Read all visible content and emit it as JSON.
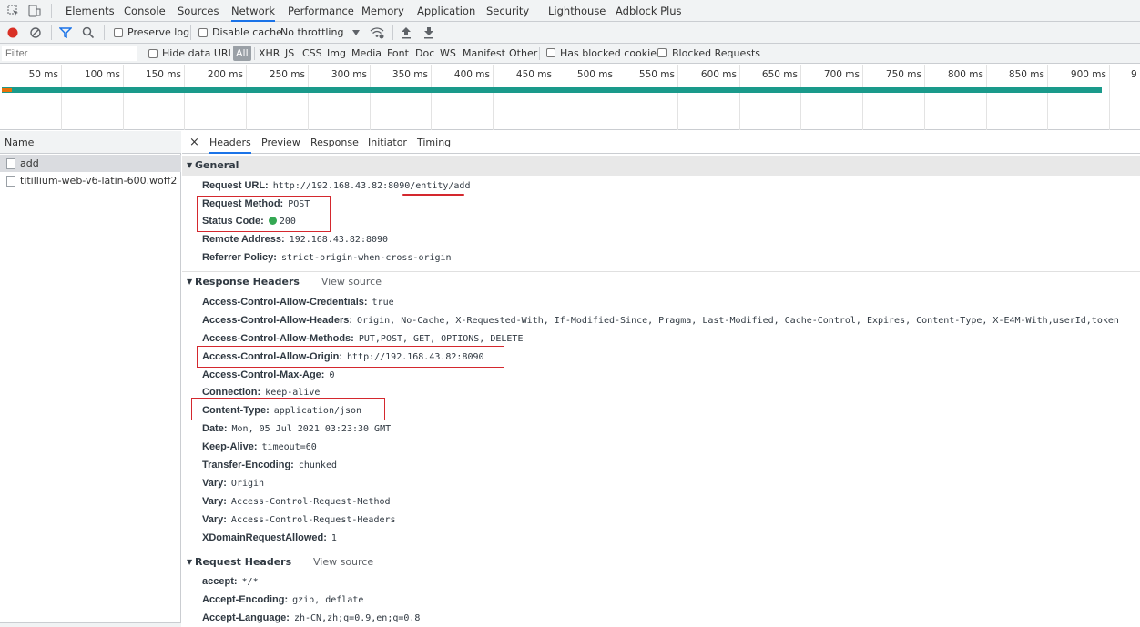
{
  "tabs": [
    "Elements",
    "Console",
    "Sources",
    "Network",
    "Performance",
    "Memory",
    "Application",
    "Security",
    "Lighthouse",
    "Adblock Plus"
  ],
  "selected_tab": "Network",
  "toolbar": {
    "preserve_log": "Preserve log",
    "disable_cache": "Disable cache",
    "throttling": "No throttling"
  },
  "filterbar": {
    "filter_placeholder": "Filter",
    "hide_data_urls": "Hide data URLs",
    "types": [
      "All",
      "XHR",
      "JS",
      "CSS",
      "Img",
      "Media",
      "Font",
      "Doc",
      "WS",
      "Manifest",
      "Other"
    ],
    "has_blocked_cookies": "Has blocked cookies",
    "blocked_requests": "Blocked Requests"
  },
  "timeline": {
    "ticks": [
      "50 ms",
      "100 ms",
      "150 ms",
      "200 ms",
      "250 ms",
      "300 ms",
      "350 ms",
      "400 ms",
      "450 ms",
      "500 ms",
      "550 ms",
      "600 ms",
      "650 ms",
      "700 ms",
      "750 ms",
      "800 ms",
      "850 ms",
      "900 ms",
      "9"
    ],
    "bar_color": "#1a9a8b",
    "bar_accent": "#e8710a"
  },
  "requests": {
    "header": "Name",
    "items": [
      "add",
      "titillium-web-v6-latin-600.woff2"
    ]
  },
  "detail_tabs": [
    "Headers",
    "Preview",
    "Response",
    "Initiator",
    "Timing"
  ],
  "close_label": "×",
  "general": {
    "title": "General",
    "rows": [
      {
        "k": "Request URL:",
        "v": "http://192.168.43.82:8090/entity/add"
      },
      {
        "k": "Request Method:",
        "v": "POST"
      },
      {
        "k": "Status Code:",
        "v": "200"
      },
      {
        "k": "Remote Address:",
        "v": "192.168.43.82:8090"
      },
      {
        "k": "Referrer Policy:",
        "v": "strict-origin-when-cross-origin"
      }
    ]
  },
  "response_headers": {
    "title": "Response Headers",
    "view_source": "View source",
    "rows": [
      {
        "k": "Access-Control-Allow-Credentials:",
        "v": "true"
      },
      {
        "k": "Access-Control-Allow-Headers:",
        "v": "Origin, No-Cache, X-Requested-With, If-Modified-Since, Pragma, Last-Modified, Cache-Control, Expires, Content-Type, X-E4M-With,userId,token"
      },
      {
        "k": "Access-Control-Allow-Methods:",
        "v": "PUT,POST, GET, OPTIONS, DELETE"
      },
      {
        "k": "Access-Control-Allow-Origin:",
        "v": "http://192.168.43.82:8090"
      },
      {
        "k": "Access-Control-Max-Age:",
        "v": "0"
      },
      {
        "k": "Connection:",
        "v": "keep-alive"
      },
      {
        "k": "Content-Type:",
        "v": "application/json"
      },
      {
        "k": "Date:",
        "v": "Mon, 05 Jul 2021 03:23:30 GMT"
      },
      {
        "k": "Keep-Alive:",
        "v": "timeout=60"
      },
      {
        "k": "Transfer-Encoding:",
        "v": "chunked"
      },
      {
        "k": "Vary:",
        "v": "Origin"
      },
      {
        "k": "Vary:",
        "v": "Access-Control-Request-Method"
      },
      {
        "k": "Vary:",
        "v": "Access-Control-Request-Headers"
      },
      {
        "k": "XDomainRequestAllowed:",
        "v": "1"
      }
    ]
  },
  "request_headers": {
    "title": "Request Headers",
    "view_source": "View source",
    "rows": [
      {
        "k": "accept:",
        "v": "*/*"
      },
      {
        "k": "Accept-Encoding:",
        "v": "gzip, deflate"
      },
      {
        "k": "Accept-Language:",
        "v": "zh-CN,zh;q=0.9,en;q=0.8"
      }
    ]
  },
  "status_color": "#34a853",
  "annotation_color": "#d4282e"
}
